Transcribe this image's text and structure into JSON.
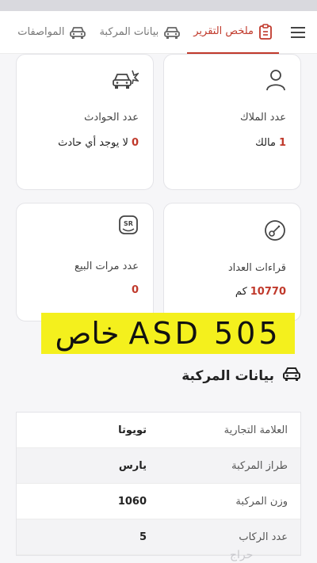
{
  "tabs": [
    {
      "label": "ملخص التقرير",
      "icon": "report-clipboard-icon",
      "active": true
    },
    {
      "label": "بيانات المركبة",
      "icon": "car-front-icon",
      "active": false
    },
    {
      "label": "المواصفات",
      "icon": "car-front-icon",
      "active": false
    }
  ],
  "cards": [
    {
      "label": "عدد الملاك",
      "value": "1",
      "unit": "مالك",
      "icon": "person-icon"
    },
    {
      "label": "عدد الحوادث",
      "value": "0",
      "unit": "لا يوجد أي حادث",
      "icon": "car-crash-icon"
    },
    {
      "label": "قراءات العداد",
      "value": "10770",
      "unit": "كم",
      "icon": "odometer-icon"
    },
    {
      "label": "عدد مرات البيع",
      "value": "0",
      "unit": "",
      "icon": "sr-badge-icon"
    }
  ],
  "overlay": {
    "plate_text": "خاص ASD 505"
  },
  "vehicle_section": {
    "title": "بيانات المركبة",
    "rows": [
      {
        "key": "العلامة التجارية",
        "value": "تويوتا"
      },
      {
        "key": "طراز المركبة",
        "value": "يارس"
      },
      {
        "key": "وزن المركبة",
        "value": "1060"
      },
      {
        "key": "عدد الركاب",
        "value": "5"
      }
    ]
  },
  "watermark": {
    "text": "حراج"
  },
  "colors": {
    "accent": "#c0392b",
    "plate_bg": "#f4f01d",
    "background": "#f6f6f8"
  }
}
